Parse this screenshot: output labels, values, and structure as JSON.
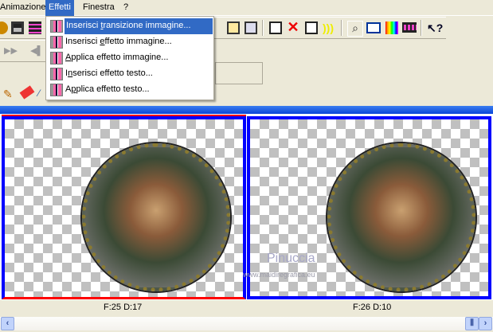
{
  "menubar": {
    "items": [
      "Animazione",
      "Effetti",
      "Finestra",
      "?"
    ],
    "active": "Effetti"
  },
  "effetti_menu": {
    "items": [
      {
        "pre": "Inserisci ",
        "key": "t",
        "post": "ransizione immagine...",
        "icon": "transition-icon"
      },
      {
        "pre": "Inserisci ",
        "key": "e",
        "post": "ffetto immagine...",
        "icon": "image-effect-icon"
      },
      {
        "pre": "",
        "key": "A",
        "post": "pplica effetto immagine...",
        "icon": "apply-image-effect-icon"
      },
      {
        "pre": "I",
        "key": "n",
        "post": "serisci effetto testo...",
        "icon": "text-effect-icon"
      },
      {
        "pre": "A",
        "key": "p",
        "post": "plica effetto testo...",
        "icon": "apply-text-effect-icon"
      }
    ]
  },
  "frames": [
    {
      "label": "F:25  D:17",
      "selected": true
    },
    {
      "label": "F:26  D:10",
      "selected": false
    }
  ],
  "watermark": {
    "name": "Pinuccia",
    "url": "www.maidiregrafica.eu"
  },
  "colors": {
    "accent": "#316ac5",
    "frame_border": "#0000ff",
    "selected": "#ff0000"
  }
}
